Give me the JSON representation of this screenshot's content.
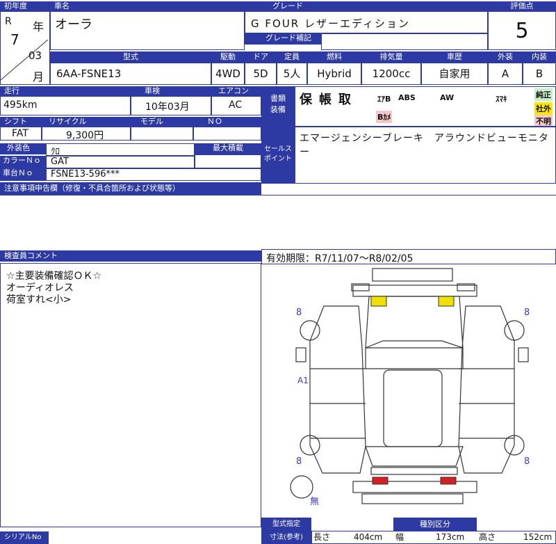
{
  "header": {
    "first_reg_label": "初年度",
    "car_name_label": "車名",
    "grade_label": "グレード",
    "score_label": "評価点",
    "era": "R",
    "year_num": "7",
    "year_unit": "年",
    "month_num": "03",
    "month_unit": "月",
    "car_name": "オーラ",
    "grade": "G FOUR レザーエディション",
    "grade_confirm_label": "グレード補記",
    "score": "5"
  },
  "spec": {
    "labels": [
      "型式",
      "駆動",
      "ドア",
      "定員",
      "燃料",
      "排気量",
      "車歴",
      "外装",
      "内装"
    ],
    "values": [
      "6AA-FSNE13",
      "4WD",
      "5D",
      "5人",
      "Hybrid",
      "1200cc",
      "自家用",
      "A",
      "B"
    ]
  },
  "row2": {
    "mileage_label": "走行",
    "inspection_label": "車検",
    "ac_label": "エアコン",
    "mileage": "495km",
    "inspection": "10年03月",
    "ac": "AC",
    "docs_label": "書類\n装備",
    "equipment": [
      "保",
      "帳",
      "取"
    ],
    "badges": [
      "ｴｱB",
      "ABS",
      "AW",
      "ｽﾏｷ",
      "純正",
      "社外",
      "不明",
      "Bｶﾒ"
    ]
  },
  "row3": {
    "shift_label": "シフト",
    "recycle_label": "リサイクル",
    "model_label": "モデル",
    "number_label": "ＮＯ",
    "shift": "FAT",
    "recycle": "9,300円"
  },
  "row4": {
    "exterior_color_label": "外装色",
    "color_no_label": "カラーＮｏ",
    "chassis_label": "車台Ｎｏ",
    "max_load_label": "最大積載",
    "exterior_color": "ｸﾛ",
    "color_no": "GAT",
    "chassis": "FSNE13-596***",
    "sales_point_label": "セールス\nポイント",
    "sales_point": "エマージェンシーブレーキ　アラウンドビューモニター"
  },
  "notes": {
    "label": "注意事項申告欄（修復・不具合箇所および状態等）",
    "text": ""
  },
  "inspector": {
    "label": "検査員コメント",
    "lines": [
      "☆主要装備確認ＯＫ☆",
      "オーディオレス",
      "荷室すれ<小>"
    ],
    "validity": "有効期限：R7/11/07〜R8/02/05"
  },
  "diagram": {
    "marks": [
      "8",
      "8",
      "8",
      "8",
      "A1",
      "無"
    ],
    "highlight_colors": {
      "yellow": "#f0e000",
      "red": "#d42020"
    }
  },
  "footer": {
    "size_label_1": "型式指定",
    "size_label_2": "寸法(参考)",
    "length_label": "長さ",
    "length": "404cm",
    "width_label": "幅",
    "width": "173cm",
    "height_label": "高さ",
    "height": "152cm",
    "category_label": "種別区分",
    "serial_label": "シリアルNo"
  }
}
